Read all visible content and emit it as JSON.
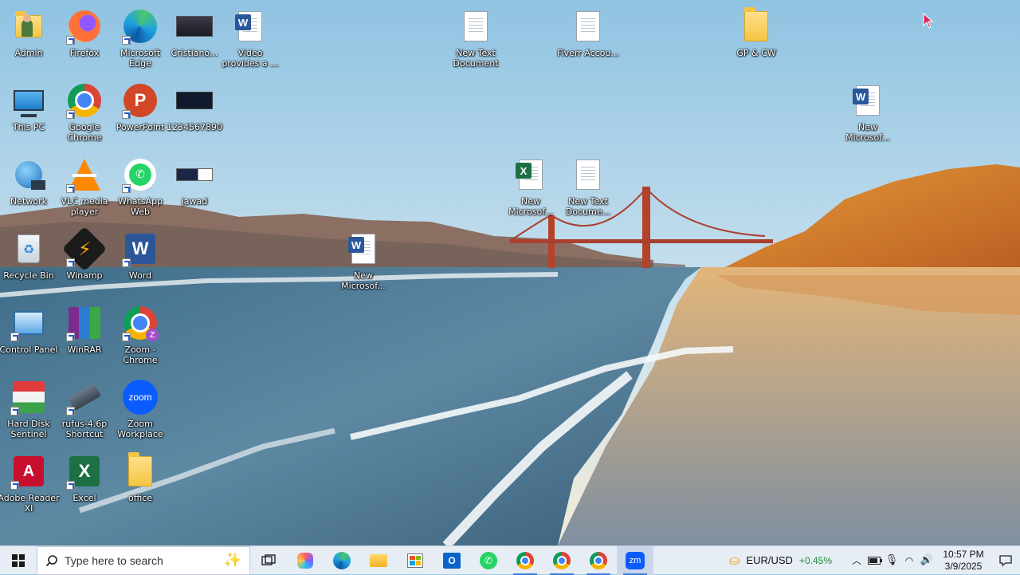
{
  "desktop": {
    "icons": [
      {
        "label": "Admin",
        "icon": "user-folder-icon"
      },
      {
        "label": "Firefox",
        "icon": "firefox-icon"
      },
      {
        "label": "Microsoft Edge",
        "icon": "edge-icon"
      },
      {
        "label": "Cristiano...",
        "icon": "image-thumbnail-icon"
      },
      {
        "label": "Video provides a ...",
        "icon": "word-doc-icon"
      },
      {
        "label": "New Text Document",
        "icon": "text-doc-icon"
      },
      {
        "label": "Fiverr Accou...",
        "icon": "text-doc-icon"
      },
      {
        "label": "GP & CW",
        "icon": "folder-icon"
      },
      {
        "label": "This PC",
        "icon": "computer-icon"
      },
      {
        "label": "Google Chrome",
        "icon": "chrome-icon"
      },
      {
        "label": "PowerPoint",
        "icon": "powerpoint-icon"
      },
      {
        "label": "1234567890",
        "icon": "image-thumbnail-icon"
      },
      {
        "label": "New Microsof...",
        "icon": "word-doc-icon"
      },
      {
        "label": "Network",
        "icon": "network-icon"
      },
      {
        "label": "VLC media player",
        "icon": "vlc-icon"
      },
      {
        "label": "WhatsApp Web",
        "icon": "whatsapp-icon"
      },
      {
        "label": "jawad",
        "icon": "image-thumbnail-icon"
      },
      {
        "label": "New Microsof...",
        "icon": "excel-doc-icon"
      },
      {
        "label": "New Text Docume...",
        "icon": "text-doc-icon"
      },
      {
        "label": "Recycle Bin",
        "icon": "recycle-bin-icon"
      },
      {
        "label": "Winamp",
        "icon": "winamp-icon"
      },
      {
        "label": "Word",
        "icon": "word-icon"
      },
      {
        "label": "New Microsof...",
        "icon": "word-doc-icon"
      },
      {
        "label": "Control Panel",
        "icon": "control-panel-icon"
      },
      {
        "label": "WinRAR",
        "icon": "winrar-icon"
      },
      {
        "label": "Zoom - Chrome",
        "icon": "chrome-zoom-icon"
      },
      {
        "label": "Hard Disk Sentinel",
        "icon": "hard-disk-sentinel-icon"
      },
      {
        "label": "rufus-4.6p Shortcut",
        "icon": "rufus-icon"
      },
      {
        "label": "Zoom Workplace",
        "icon": "zoom-icon"
      },
      {
        "label": "Adobe Reader XI",
        "icon": "adobe-reader-icon"
      },
      {
        "label": "Excel",
        "icon": "excel-icon"
      },
      {
        "label": "office",
        "icon": "folder-icon"
      }
    ]
  },
  "taskbar": {
    "search_placeholder": "Type here to search",
    "apps": [
      "task-view-icon",
      "copilot-icon",
      "edge-icon",
      "file-explorer-icon",
      "microsoft-store-icon",
      "outlook-icon",
      "whatsapp-icon",
      "chrome-profile-icon",
      "chrome-icon",
      "chrome-meet-icon",
      "zoom-icon"
    ],
    "ticker": {
      "symbol": "EUR/USD",
      "change": "+0.45%",
      "change_color": "#1a8f3a"
    },
    "clock": {
      "time": "10:57 PM",
      "date": "3/9/2025"
    }
  }
}
